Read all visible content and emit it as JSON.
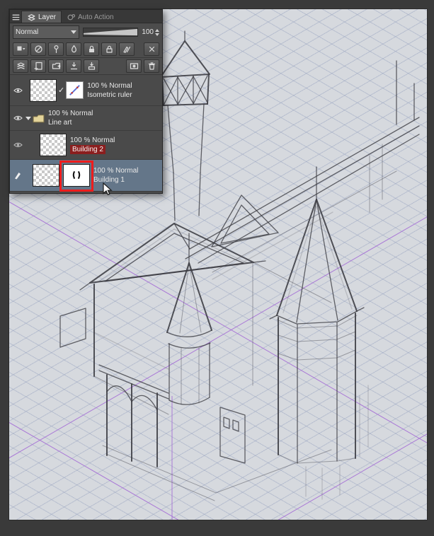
{
  "layer_panel": {
    "tabs": [
      {
        "label": "Layer"
      },
      {
        "label": "Auto Action"
      }
    ],
    "blend_mode": "Normal",
    "opacity_value": "100",
    "layers": [
      {
        "opacity": "100 % Normal",
        "name": "Isometric ruler"
      },
      {
        "opacity": "100 % Normal",
        "name": "Line art"
      },
      {
        "opacity": "100 % Normal",
        "name": "Building 2"
      },
      {
        "opacity": "100 % Normal",
        "name": "Building 1"
      }
    ]
  },
  "canvas": {
    "colors": {
      "background": "#d6d9de",
      "grid_line": "#94a0be",
      "ruler_guide": "#a56fd6",
      "line_art": "#3e3e45"
    }
  },
  "annotations": {
    "highlight_color": "#ee1c1c",
    "building2_label_bg": "#8b1e1e"
  },
  "colors": {
    "frame": "#3a3a3a",
    "panel_background": "#4c4c4c",
    "selected_layer_row": "#647689"
  }
}
